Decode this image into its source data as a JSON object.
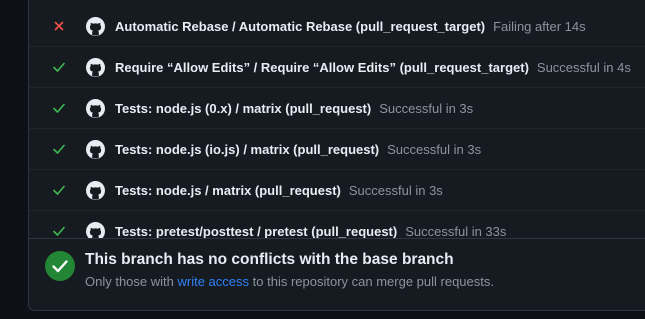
{
  "checks": [
    {
      "status": "failure",
      "status_icon": "x-icon",
      "name": "Automatic Rebase / Automatic Rebase (pull_request_target)",
      "result": "Failing after 14s"
    },
    {
      "status": "success",
      "status_icon": "check-icon",
      "name": "Require “Allow Edits” / Require “Allow Edits” (pull_request_target)",
      "result": "Successful in 4s"
    },
    {
      "status": "success",
      "status_icon": "check-icon",
      "name": "Tests: node.js (0.x) / matrix (pull_request)",
      "result": "Successful in 3s"
    },
    {
      "status": "success",
      "status_icon": "check-icon",
      "name": "Tests: node.js (io.js) / matrix (pull_request)",
      "result": "Successful in 3s"
    },
    {
      "status": "success",
      "status_icon": "check-icon",
      "name": "Tests: node.js / matrix (pull_request)",
      "result": "Successful in 3s"
    },
    {
      "status": "success",
      "status_icon": "check-icon",
      "name": "Tests: pretest/posttest / pretest (pull_request)",
      "result": "Successful in 33s"
    }
  ],
  "merge": {
    "title": "This branch has no conflicts with the base branch",
    "desc_prefix": "Only those with ",
    "desc_link": "write access",
    "desc_suffix": " to this repository can merge pull requests."
  },
  "colors": {
    "success": "#3fb950",
    "failure": "#f85149",
    "merge_icon": "#238636",
    "link": "#2f81f7"
  }
}
